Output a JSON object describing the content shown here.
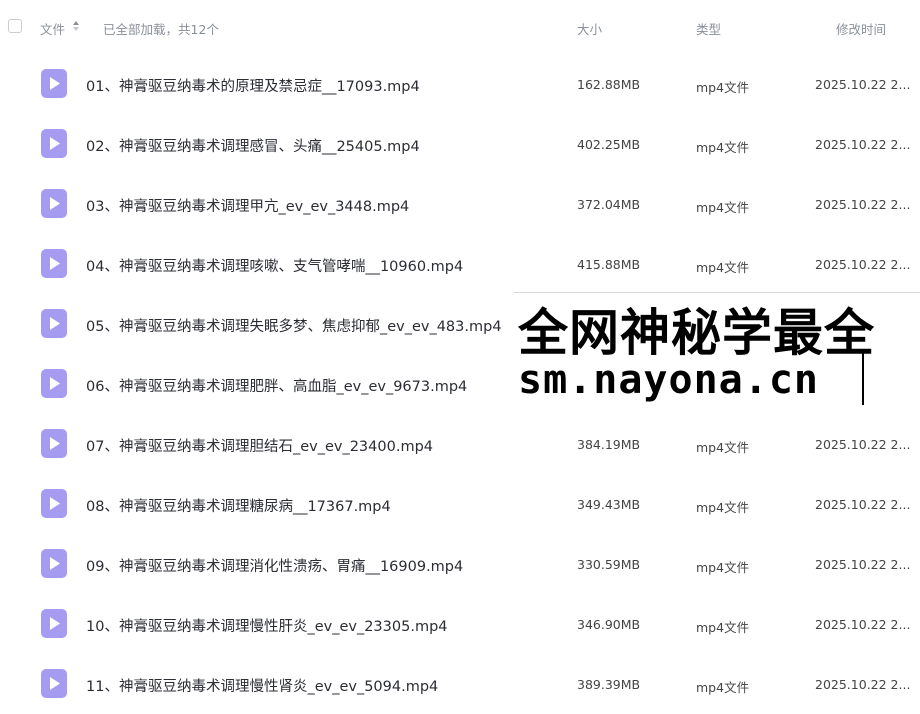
{
  "header": {
    "name_label": "文件",
    "status": "已全部加载，共12个",
    "size_label": "大小",
    "type_label": "类型",
    "time_label": "修改时间"
  },
  "files": [
    {
      "name": "01、神膏驱豆纳毒术的原理及禁忌症__17093.mp4",
      "size": "162.88MB",
      "type": "mp4文件",
      "time": "2025.10.22 2..."
    },
    {
      "name": "02、神膏驱豆纳毒术调理感冒、头痛__25405.mp4",
      "size": "402.25MB",
      "type": "mp4文件",
      "time": "2025.10.22 2..."
    },
    {
      "name": "03、神膏驱豆纳毒术调理甲亢_ev_ev_3448.mp4",
      "size": "372.04MB",
      "type": "mp4文件",
      "time": "2025.10.22 2..."
    },
    {
      "name": "04、神膏驱豆纳毒术调理咳嗽、支气管哮喘__10960.mp4",
      "size": "415.88MB",
      "type": "mp4文件",
      "time": "2025.10.22 2..."
    },
    {
      "name": "05、神膏驱豆纳毒术调理失眠多梦、焦虑抑郁_ev_ev_483.mp4",
      "size": "",
      "type": "",
      "time": ""
    },
    {
      "name": "06、神膏驱豆纳毒术调理肥胖、高血脂_ev_ev_9673.mp4",
      "size": "",
      "type": "",
      "time": ""
    },
    {
      "name": "07、神膏驱豆纳毒术调理胆结石_ev_ev_23400.mp4",
      "size": "384.19MB",
      "type": "mp4文件",
      "time": "2025.10.22 2..."
    },
    {
      "name": "08、神膏驱豆纳毒术调理糖尿病__17367.mp4",
      "size": "349.43MB",
      "type": "mp4文件",
      "time": "2025.10.22 2..."
    },
    {
      "name": "09、神膏驱豆纳毒术调理消化性溃疡、胃痛__16909.mp4",
      "size": "330.59MB",
      "type": "mp4文件",
      "time": "2025.10.22 2..."
    },
    {
      "name": "10、神膏驱豆纳毒术调理慢性肝炎_ev_ev_23305.mp4",
      "size": "346.90MB",
      "type": "mp4文件",
      "time": "2025.10.22 2..."
    },
    {
      "name": "11、神膏驱豆纳毒术调理慢性肾炎_ev_ev_5094.mp4",
      "size": "389.39MB",
      "type": "mp4文件",
      "time": "2025.10.22 2..."
    }
  ],
  "overlay": {
    "line1": "全网神秘学最全",
    "line2": "sm.nayona.cn"
  },
  "colors": {
    "icon_bg": "#a59cf2",
    "icon_play": "#ffffff"
  },
  "icons": {
    "file": "video-file-icon",
    "sort": "sort-icon"
  }
}
